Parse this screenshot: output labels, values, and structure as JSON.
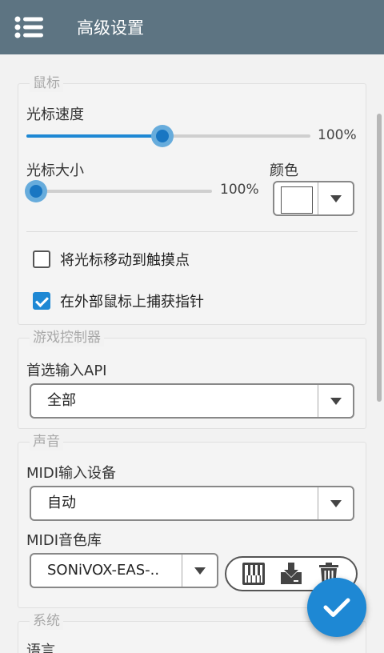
{
  "header": {
    "title": "高级设置",
    "menu_icon": "hamburger-menu-icon"
  },
  "mouse": {
    "legend": "鼠标",
    "cursor_speed_label": "光标速度",
    "cursor_speed_value": "100%",
    "cursor_speed_fraction": 0.48,
    "cursor_size_label": "光标大小",
    "cursor_size_value": "100%",
    "cursor_size_fraction": 0.0,
    "color_label": "颜色",
    "cursor_color": "#ffffff",
    "move_cursor_to_touch_label": "将光标移动到触摸点",
    "move_cursor_to_touch_checked": false,
    "capture_pointer_label": "在外部鼠标上捕获指针",
    "capture_pointer_checked": true
  },
  "gamepad": {
    "legend": "游戏控制器",
    "input_api_label": "首选输入API",
    "input_api_value": "全部"
  },
  "sound": {
    "legend": "声音",
    "midi_input_label": "MIDI输入设备",
    "midi_input_value": "自动",
    "soundfont_label": "MIDI音色库",
    "soundfont_value": "SONiVOX-EAS-..",
    "soundfont_icons": [
      "piano-keys-icon",
      "download-icon",
      "trash-icon"
    ]
  },
  "system": {
    "legend": "系统",
    "language_label": "语言"
  },
  "colors": {
    "accent": "#1e88d4",
    "topbar": "#5d7482"
  }
}
